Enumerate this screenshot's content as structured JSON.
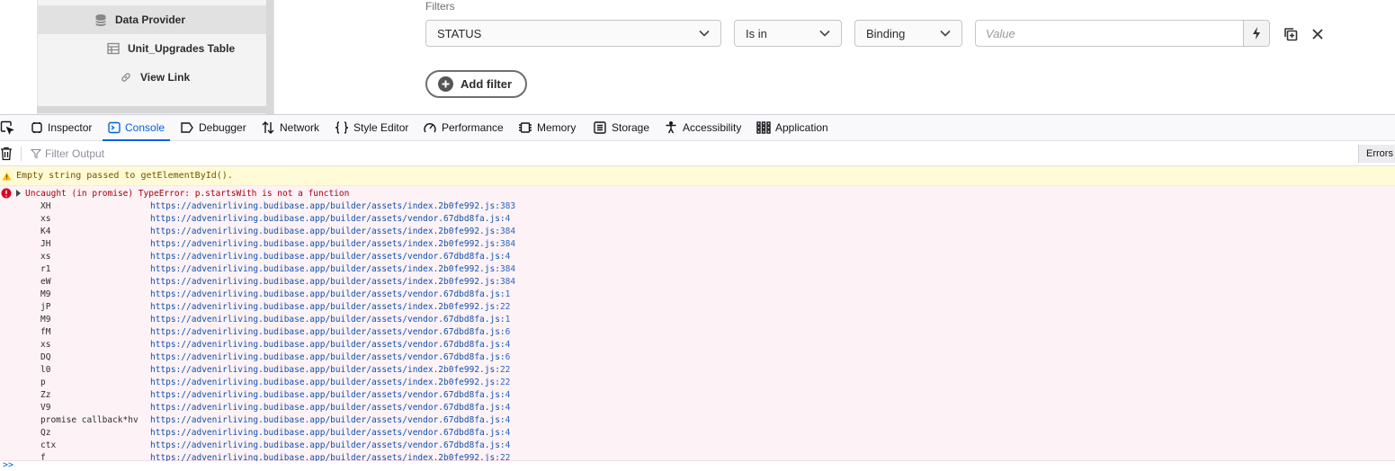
{
  "tree": {
    "items": [
      {
        "label": "Data Provider",
        "icon": "database-icon",
        "indent": 1
      },
      {
        "label": "Unit_Upgrades Table",
        "icon": "table-icon",
        "indent": 2
      },
      {
        "label": "View Link",
        "icon": "link-icon",
        "indent": 2
      }
    ]
  },
  "filters": {
    "label": "Filters",
    "field": "STATUS",
    "operator": "Is in",
    "type": "Binding",
    "value_placeholder": "Value",
    "add_filter_label": "Add filter"
  },
  "devtools": {
    "tabs": [
      "Inspector",
      "Console",
      "Debugger",
      "Network",
      "Style Editor",
      "Performance",
      "Memory",
      "Storage",
      "Accessibility",
      "Application"
    ],
    "active_tab": "Console",
    "filter_placeholder": "Filter Output",
    "errors_label": "Errors",
    "warning": "Empty string passed to getElementById().",
    "error": "Uncaught (in promise) TypeError: p.startsWith is not a function",
    "stack": [
      {
        "fn": "XH",
        "url": "https://advenirliving.budibase.app/builder/assets/index.2b0fe992.js",
        "line": "383"
      },
      {
        "fn": "xs",
        "url": "https://advenirliving.budibase.app/builder/assets/vendor.67dbd8fa.js",
        "line": "4"
      },
      {
        "fn": "K4",
        "url": "https://advenirliving.budibase.app/builder/assets/index.2b0fe992.js",
        "line": "384"
      },
      {
        "fn": "JH",
        "url": "https://advenirliving.budibase.app/builder/assets/index.2b0fe992.js",
        "line": "384"
      },
      {
        "fn": "xs",
        "url": "https://advenirliving.budibase.app/builder/assets/vendor.67dbd8fa.js",
        "line": "4"
      },
      {
        "fn": "r1",
        "url": "https://advenirliving.budibase.app/builder/assets/index.2b0fe992.js",
        "line": "384"
      },
      {
        "fn": "eW",
        "url": "https://advenirliving.budibase.app/builder/assets/index.2b0fe992.js",
        "line": "384"
      },
      {
        "fn": "M9",
        "url": "https://advenirliving.budibase.app/builder/assets/vendor.67dbd8fa.js",
        "line": "1"
      },
      {
        "fn": "jP",
        "url": "https://advenirliving.budibase.app/builder/assets/index.2b0fe992.js",
        "line": "22"
      },
      {
        "fn": "M9",
        "url": "https://advenirliving.budibase.app/builder/assets/vendor.67dbd8fa.js",
        "line": "1"
      },
      {
        "fn": "fM",
        "url": "https://advenirliving.budibase.app/builder/assets/vendor.67dbd8fa.js",
        "line": "6"
      },
      {
        "fn": "xs",
        "url": "https://advenirliving.budibase.app/builder/assets/vendor.67dbd8fa.js",
        "line": "4"
      },
      {
        "fn": "DQ",
        "url": "https://advenirliving.budibase.app/builder/assets/vendor.67dbd8fa.js",
        "line": "6"
      },
      {
        "fn": "l0",
        "url": "https://advenirliving.budibase.app/builder/assets/index.2b0fe992.js",
        "line": "22"
      },
      {
        "fn": "p",
        "url": "https://advenirliving.budibase.app/builder/assets/index.2b0fe992.js",
        "line": "22"
      },
      {
        "fn": "Zz",
        "url": "https://advenirliving.budibase.app/builder/assets/vendor.67dbd8fa.js",
        "line": "4"
      },
      {
        "fn": "V9",
        "url": "https://advenirliving.budibase.app/builder/assets/vendor.67dbd8fa.js",
        "line": "4"
      },
      {
        "fn": "promise callback*hv",
        "url": "https://advenirliving.budibase.app/builder/assets/vendor.67dbd8fa.js",
        "line": "4"
      },
      {
        "fn": "Qz",
        "url": "https://advenirliving.budibase.app/builder/assets/vendor.67dbd8fa.js",
        "line": "4"
      },
      {
        "fn": "ctx",
        "url": "https://advenirliving.budibase.app/builder/assets/vendor.67dbd8fa.js",
        "line": "4"
      },
      {
        "fn": "f",
        "url": "https://advenirliving.budibase.app/builder/assets/index.2b0fe992.js",
        "line": "22"
      }
    ],
    "prompt": ">>"
  }
}
